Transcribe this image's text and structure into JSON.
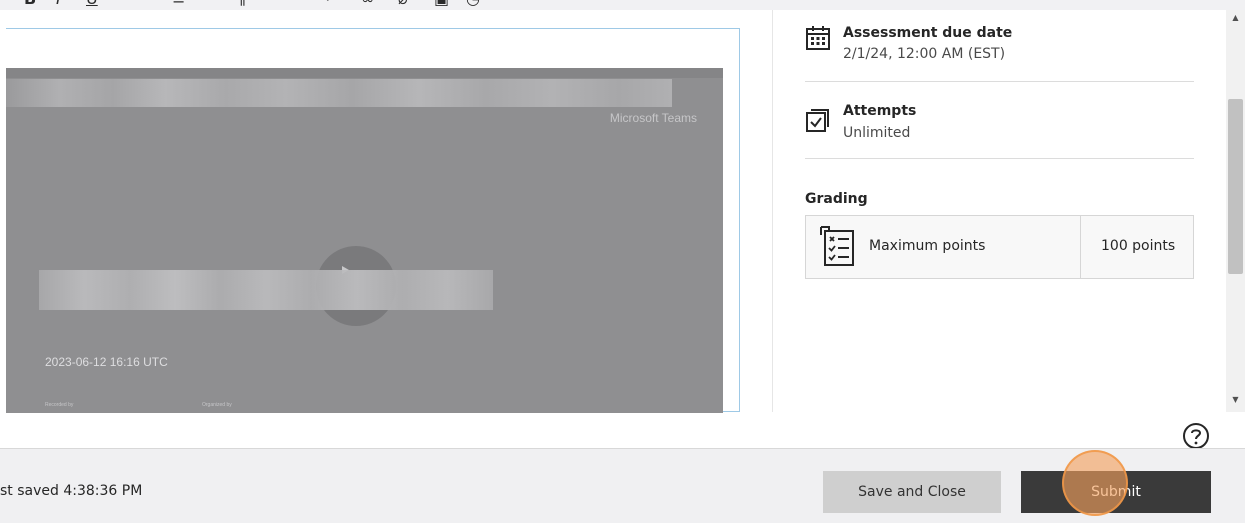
{
  "editor": {
    "video": {
      "brand": "Microsoft Teams",
      "timestamp": "2023-06-12 16:16 UTC",
      "recorded_by_label": "Recorded by",
      "organized_by_label": "Organized by"
    }
  },
  "details": {
    "due_date": {
      "title": "Assessment due date",
      "value": "2/1/24, 12:00 AM (EST)",
      "icon": "calendar-icon"
    },
    "attempts": {
      "title": "Attempts",
      "value": "Unlimited",
      "icon": "attempts-checkbox-icon"
    },
    "grading": {
      "label": "Grading",
      "item_label": "Maximum points",
      "item_value": "100 points",
      "icon": "rubric-checklist-icon"
    }
  },
  "footer": {
    "saved_text": "st saved 4:38:36 PM",
    "save_close_label": "Save and Close",
    "submit_label": "Submit"
  },
  "colors": {
    "submit_bg": "#3a3a3a",
    "save_close_bg": "#cfcfcf",
    "editor_border": "#9ec9e6",
    "click_indicator": "#f3a05c"
  }
}
